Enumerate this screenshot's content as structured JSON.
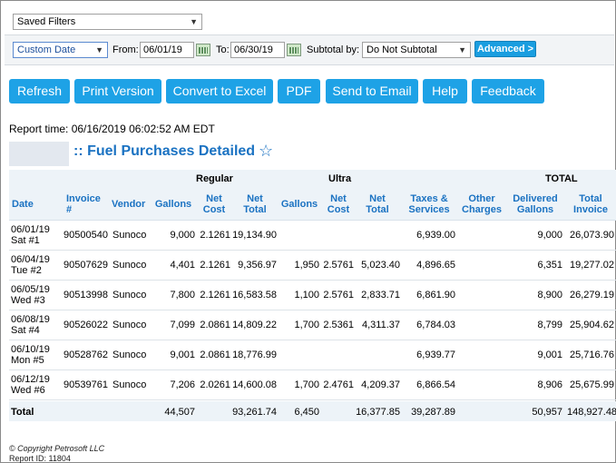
{
  "saved_filters": {
    "value": "Saved Filters"
  },
  "filters": {
    "date_range": "Custom Date",
    "from_label": "From:",
    "from_value": "06/01/19",
    "to_label": "To:",
    "to_value": "06/30/19",
    "subtotal_label": "Subtotal by:",
    "subtotal_value": "Do Not Subtotal",
    "advanced_label": "Advanced >"
  },
  "toolbar": {
    "refresh": "Refresh",
    "print": "Print Version",
    "excel": "Convert to Excel",
    "pdf": "PDF",
    "email": "Send to Email",
    "help": "Help",
    "feedback": "Feedback"
  },
  "report": {
    "time": "Report time: 06/16/2019 06:02:52 AM EDT",
    "title": ":: Fuel Purchases Detailed"
  },
  "table": {
    "groups": {
      "regular": "Regular",
      "ultra": "Ultra",
      "total": "TOTAL"
    },
    "headers": {
      "date": "Date",
      "invoice": "Invoice #",
      "vendor": "Vendor",
      "reg_gallons": "Gallons",
      "reg_net_cost": "Net Cost",
      "reg_net_total": "Net Total",
      "ult_gallons": "Gallons",
      "ult_net_cost": "Net Cost",
      "ult_net_total": "Net Total",
      "taxes": "Taxes & Services",
      "other": "Other Charges",
      "delivered": "Delivered Gallons",
      "total_invoice": "Total Invoice"
    },
    "rows": [
      {
        "date1": "06/01/19",
        "date2": "Sat #1",
        "invoice": "90500540",
        "vendor": "Sunoco",
        "reg_gallons": "9,000",
        "reg_net_cost": "2.1261",
        "reg_net_total": "19,134.90",
        "ult_gallons": "",
        "ult_net_cost": "",
        "ult_net_total": "",
        "taxes": "6,939.00",
        "other": "",
        "delivered": "9,000",
        "total_invoice": "26,073.90"
      },
      {
        "date1": "06/04/19",
        "date2": "Tue #2",
        "invoice": "90507629",
        "vendor": "Sunoco",
        "reg_gallons": "4,401",
        "reg_net_cost": "2.1261",
        "reg_net_total": "9,356.97",
        "ult_gallons": "1,950",
        "ult_net_cost": "2.5761",
        "ult_net_total": "5,023.40",
        "taxes": "4,896.65",
        "other": "",
        "delivered": "6,351",
        "total_invoice": "19,277.02"
      },
      {
        "date1": "06/05/19",
        "date2": "Wed #3",
        "invoice": "90513998",
        "vendor": "Sunoco",
        "reg_gallons": "7,800",
        "reg_net_cost": "2.1261",
        "reg_net_total": "16,583.58",
        "ult_gallons": "1,100",
        "ult_net_cost": "2.5761",
        "ult_net_total": "2,833.71",
        "taxes": "6,861.90",
        "other": "",
        "delivered": "8,900",
        "total_invoice": "26,279.19"
      },
      {
        "date1": "06/08/19",
        "date2": "Sat #4",
        "invoice": "90526022",
        "vendor": "Sunoco",
        "reg_gallons": "7,099",
        "reg_net_cost": "2.0861",
        "reg_net_total": "14,809.22",
        "ult_gallons": "1,700",
        "ult_net_cost": "2.5361",
        "ult_net_total": "4,311.37",
        "taxes": "6,784.03",
        "other": "",
        "delivered": "8,799",
        "total_invoice": "25,904.62"
      },
      {
        "date1": "06/10/19",
        "date2": "Mon #5",
        "invoice": "90528762",
        "vendor": "Sunoco",
        "reg_gallons": "9,001",
        "reg_net_cost": "2.0861",
        "reg_net_total": "18,776.99",
        "ult_gallons": "",
        "ult_net_cost": "",
        "ult_net_total": "",
        "taxes": "6,939.77",
        "other": "",
        "delivered": "9,001",
        "total_invoice": "25,716.76"
      },
      {
        "date1": "06/12/19",
        "date2": "Wed #6",
        "invoice": "90539761",
        "vendor": "Sunoco",
        "reg_gallons": "7,206",
        "reg_net_cost": "2.0261",
        "reg_net_total": "14,600.08",
        "ult_gallons": "1,700",
        "ult_net_cost": "2.4761",
        "ult_net_total": "4,209.37",
        "taxes": "6,866.54",
        "other": "",
        "delivered": "8,906",
        "total_invoice": "25,675.99"
      }
    ],
    "total": {
      "label": "Total",
      "reg_gallons": "44,507",
      "reg_net_total": "93,261.74",
      "ult_gallons": "6,450",
      "ult_net_total": "16,377.85",
      "taxes": "39,287.89",
      "delivered": "50,957",
      "total_invoice": "148,927.48"
    }
  },
  "footer": {
    "copyright": "© Copyright Petrosoft LLC",
    "report_id": "Report ID: 11804"
  },
  "colors": {
    "accent": "#1ea2e6",
    "title": "#1a72c2",
    "header_bg": "#edf3f8"
  }
}
